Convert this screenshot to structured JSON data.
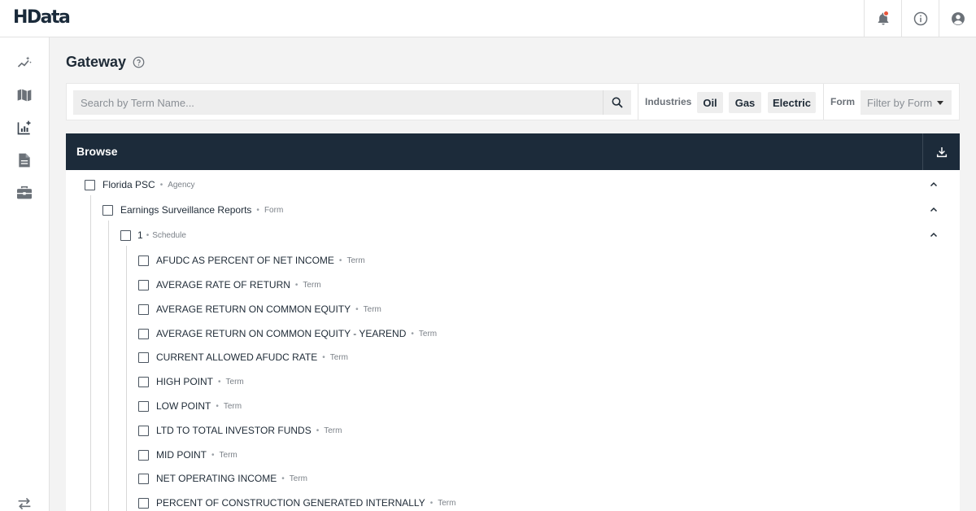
{
  "app": {
    "logo": "HData"
  },
  "colors": {
    "header_dark": "#1c2b3a",
    "accent_notification": "#e8553b",
    "background": "#f3f3f3"
  },
  "topbar": {
    "actions": [
      {
        "icon": "bell-icon",
        "has_notification": true
      },
      {
        "icon": "info-icon"
      },
      {
        "icon": "user-account-icon"
      }
    ]
  },
  "sidebar": {
    "items": [
      {
        "icon": "sparkle-chart-icon"
      },
      {
        "icon": "map-book-icon"
      },
      {
        "icon": "chart-add-icon"
      },
      {
        "icon": "document-icon"
      },
      {
        "icon": "briefcase-icon"
      },
      {
        "icon": "swap-arrows-icon"
      }
    ]
  },
  "page": {
    "title": "Gateway"
  },
  "filters": {
    "search_placeholder": "Search by Term Name...",
    "industries_label": "Industries",
    "industries": [
      "Oil",
      "Gas",
      "Electric"
    ],
    "form_label": "Form",
    "form_placeholder": "Filter by Form"
  },
  "browse": {
    "title": "Browse",
    "separator": "•",
    "agency": {
      "name": "Florida PSC",
      "type": "Agency"
    },
    "form": {
      "name": "Earnings Surveillance Reports",
      "type": "Form"
    },
    "schedule": {
      "name": "1",
      "type": "Schedule"
    },
    "terms": [
      {
        "name": "AFUDC AS PERCENT OF NET INCOME",
        "type": "Term"
      },
      {
        "name": "AVERAGE RATE OF RETURN",
        "type": "Term"
      },
      {
        "name": "AVERAGE RETURN ON COMMON EQUITY",
        "type": "Term"
      },
      {
        "name": "AVERAGE RETURN ON COMMON EQUITY - YEAREND",
        "type": "Term"
      },
      {
        "name": "CURRENT ALLOWED AFUDC RATE",
        "type": "Term"
      },
      {
        "name": "HIGH POINT",
        "type": "Term"
      },
      {
        "name": "LOW POINT",
        "type": "Term"
      },
      {
        "name": "LTD TO TOTAL INVESTOR FUNDS",
        "type": "Term"
      },
      {
        "name": "MID POINT",
        "type": "Term"
      },
      {
        "name": "NET OPERATING INCOME",
        "type": "Term"
      },
      {
        "name": "PERCENT OF CONSTRUCTION GENERATED INTERNALLY",
        "type": "Term"
      }
    ]
  }
}
